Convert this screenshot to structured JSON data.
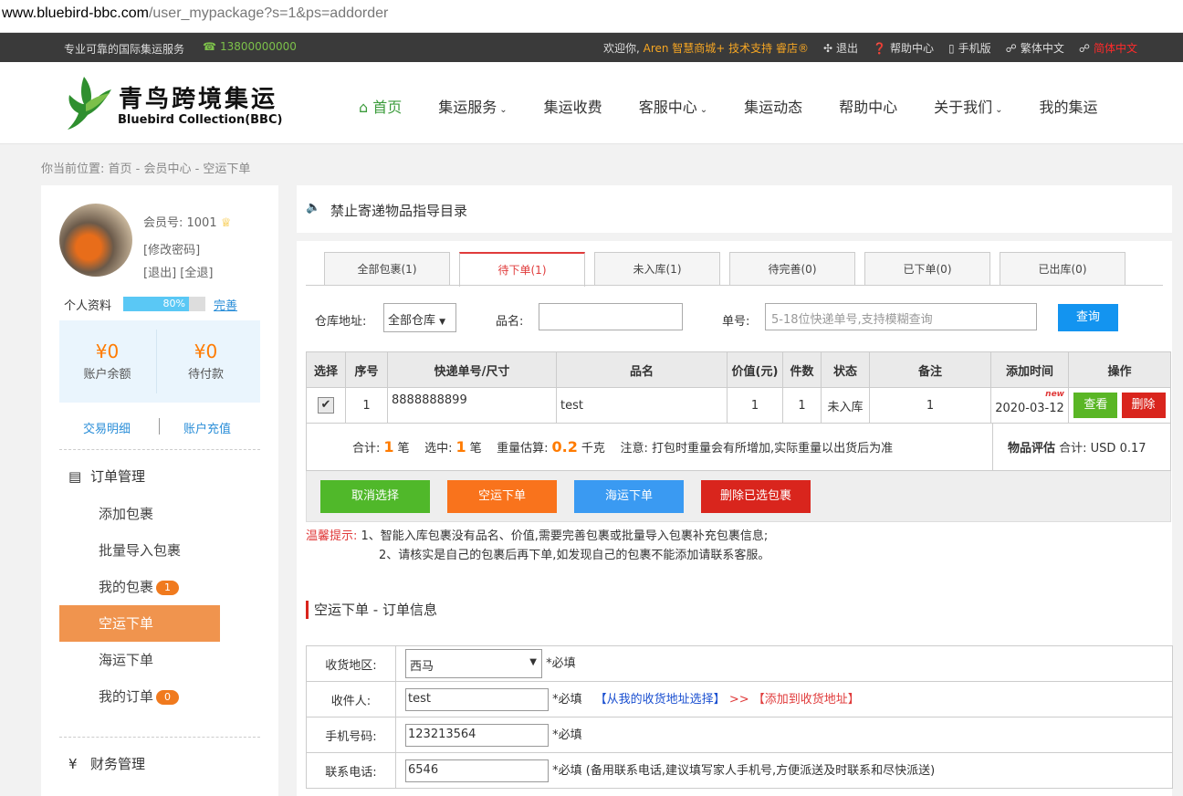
{
  "browser": {
    "url_host": "www.bluebird-bbc.com",
    "url_path": "/user_mypackage?s=1&ps=addorder"
  },
  "topbar": {
    "slogan": "专业可靠的国际集运服务",
    "phone": "13800000000",
    "welcome": "欢迎你,",
    "user_link": "Aren 智慧商城+ 技术支持 睿店®",
    "logout": "退出",
    "help": "帮助中心",
    "mobile": "手机版",
    "traditional": "繁体中文",
    "simplified": "简体中文"
  },
  "logo": {
    "cn": "青鸟跨境集运",
    "en": "Bluebird Collection(BBC)"
  },
  "nav": [
    {
      "label": "首页",
      "chevron": false
    },
    {
      "label": "集运服务",
      "chevron": true
    },
    {
      "label": "集运收费",
      "chevron": false
    },
    {
      "label": "客服中心",
      "chevron": true
    },
    {
      "label": "集运动态",
      "chevron": false
    },
    {
      "label": "帮助中心",
      "chevron": false
    },
    {
      "label": "关于我们",
      "chevron": true
    },
    {
      "label": "我的集运",
      "chevron": false
    }
  ],
  "breadcrumb": "你当前位置: 首页 - 会员中心 - 空运下单",
  "sidebar": {
    "member_id": "会员号: 1001",
    "change_pw": "[修改密码]",
    "logout_links": "[退出] [全退]",
    "profile_label": "个人资料",
    "profile_pct_text": "80%",
    "profile_pct": 80,
    "profile_link": "完善",
    "balance": {
      "amount": "¥0",
      "label": "账户余额"
    },
    "pending": {
      "amount": "¥0",
      "label": "待付款"
    },
    "tx_link": "交易明细",
    "recharge_link": "账户充值",
    "order_mgmt": "订单管理",
    "items": [
      {
        "label": "添加包裹",
        "badge": ""
      },
      {
        "label": "批量导入包裹",
        "badge": ""
      },
      {
        "label": "我的包裹",
        "badge": "1"
      },
      {
        "label": "空运下单",
        "badge": ""
      },
      {
        "label": "海运下单",
        "badge": ""
      },
      {
        "label": "我的订单",
        "badge": "0"
      }
    ],
    "finance_mgmt": "财务管理"
  },
  "notice": "禁止寄递物品指导目录",
  "tabs": [
    "全部包裹(1)",
    "待下单(1)",
    "未入库(1)",
    "待完善(0)",
    "已下单(0)",
    "已出库(0)"
  ],
  "filter": {
    "warehouse_label": "仓库地址:",
    "warehouse_value": "全部仓库",
    "name_label": "品名:",
    "no_label": "单号:",
    "no_placeholder": "5-18位快递单号,支持模糊查询",
    "search_btn": "查询"
  },
  "table": {
    "headers": [
      "选择",
      "序号",
      "快递单号/尺寸",
      "品名",
      "价值(元)",
      "件数",
      "状态",
      "备注",
      "添加时间",
      "操作"
    ],
    "row": {
      "seq": "1",
      "tracking": "8888888899",
      "name": "test",
      "value": "1",
      "qty": "1",
      "status": "未入库",
      "note": "1",
      "date": "2020-03-12",
      "new": "new",
      "view": "查看",
      "delete": "删除"
    }
  },
  "summary": {
    "total_label": "合计:",
    "total": "1",
    "unit1": "笔",
    "selected_label": "选中:",
    "selected": "1",
    "unit2": "笔",
    "weight_label": "重量估算:",
    "weight": "0.2",
    "weight_unit": "千克",
    "note": "注意: 打包时重量会有所增加,实际重量以出货后为准",
    "eval_label": "物品评估",
    "eval_value": "合计: USD 0.17"
  },
  "actions": [
    "取消选择",
    "空运下单",
    "海运下单",
    "删除已选包裹"
  ],
  "tips": {
    "label": "温馨提示:",
    "line1": "1、智能入库包裹没有品名、价值,需要完善包裹或批量导入包裹补充包裹信息;",
    "line2": "2、请核实是自己的包裹后再下单,如发现自己的包裹不能添加请联系客服。"
  },
  "order_section": "空运下单 - 订单信息",
  "form": {
    "region_label": "收货地区:",
    "region_value": "西马",
    "req": "*必填",
    "recipient_label": "收件人:",
    "recipient_value": "test",
    "choose_addr": "【从我的收货地址选择】",
    "arrows": ">>",
    "add_addr": "【添加到收货地址】",
    "mobile_label": "手机号码:",
    "mobile_value": "123213564",
    "phone_label": "联系电话:",
    "phone_value": "6546",
    "phone_note": "*必填 (备用联系电话,建议填写家人手机号,方便派送及时联系和尽快派送)"
  },
  "colors": {
    "accent_green": "#3b9b3b",
    "accent_orange": "#f0944e",
    "danger_red": "#d9251d",
    "btn_blue": "#1394f0"
  }
}
